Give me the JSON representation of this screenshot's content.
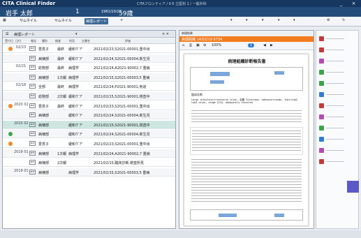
{
  "window": {
    "title": "CITA Clinical Finder",
    "subtitle": "CITAフロンティア / 9 E 立医科 1 / 一般外科",
    "min": "_",
    "close": "×"
  },
  "patient": {
    "name": "岩手 太郎",
    "id": "1",
    "dob": "1961/10/28",
    "age": "59歳"
  },
  "toolbar": {
    "items": [
      "サムネイル",
      "サムネイル",
      "病理レポート",
      "+"
    ],
    "right_items": [
      "▾",
      "▾",
      "▾",
      "▾",
      "▾",
      "⚙",
      "↻"
    ]
  },
  "left": {
    "filter": "病理レポート",
    "filter_arrow": "▾",
    "close": "× ✕",
    "columns": [
      "受付日",
      "日付",
      "報告",
      "種別",
      "検査",
      "所見",
      "文書名",
      "評価"
    ],
    "rows": [
      {
        "date": "02/23",
        "dot": "#f08a24",
        "icon": "PDF",
        "c1": "豊見子",
        "c2": "最終",
        "c3": "緩和ケア",
        "doc": "2021/02/23,S2021-00001,重中出"
      },
      {
        "date": "",
        "dot": "",
        "icon": "PDF",
        "c1": "病棟部",
        "c2": "最終",
        "c3": "緩和ケア",
        "doc": "2021/02/24,S2021-00004,新生児"
      },
      {
        "date": "02/21",
        "dot": "",
        "icon": "PDF",
        "c1": "総務部",
        "c2": "最終",
        "c3": "病理学",
        "doc": "2021/02/24,A2021-90002,7 重病"
      },
      {
        "date": "",
        "dot": "",
        "icon": "PDF",
        "c1": "病棟部",
        "c2": "1次報",
        "c3": "病理学",
        "doc": "2021/02/15,S2021-00003,5 重病"
      },
      {
        "date": "02/18",
        "dot": "",
        "icon": "PDF",
        "c1": "全部",
        "c2": "最終",
        "c3": "病理学",
        "doc": "2021/02/24,P2021-90001,気道"
      },
      {
        "date": "",
        "dot": "",
        "icon": "PDF",
        "c1": "総務部",
        "c2": "2次報",
        "c3": "緩和ケア",
        "doc": "2021/02/15,S2021-90001,検査中"
      },
      {
        "date": "2020 02/22",
        "dot": "#f08a24",
        "icon": "PDF",
        "c1": "豊見子",
        "c2": "最終",
        "c3": "緩和ケア",
        "doc": "2021/02/23,S2021-00001,重中出"
      },
      {
        "date": "",
        "dot": "",
        "icon": "PDF",
        "c1": "病棟部",
        "c2": "",
        "c3": "緩和ケア",
        "doc": "2021/02/24,S2021-00004,新生児"
      },
      {
        "date": "2020 02/20",
        "dot": "",
        "icon": "PDF",
        "c1": "病棟部",
        "c2": "",
        "c3": "緩和ケア",
        "doc": "2021/02/15,S2021-90001,検査中",
        "selected": true
      },
      {
        "date": "",
        "dot": "#3aa64c",
        "icon": "PDF",
        "c1": "病棟部",
        "c2": "",
        "c3": "緩和ケア",
        "doc": "2021/02/24,S2021-00004,新生児"
      },
      {
        "date": "",
        "dot": "#f08a24",
        "icon": "PDF",
        "c1": "豊見子",
        "c2": "",
        "c3": "緩和ケア",
        "doc": "2021/02/23,S2021-00001,重中出"
      },
      {
        "date": "2019 01/25",
        "dot": "",
        "icon": "PDF",
        "c1": "病棟部",
        "c2": "1次報",
        "c3": "病理学",
        "doc": "2021/02/24,A2021-90002,7 重病"
      },
      {
        "date": "",
        "dot": "",
        "icon": "PDF",
        "c1": "病棟部",
        "c2": "2次報",
        "c3": "",
        "doc": "2021/02/15,臨床診断,検査所見"
      },
      {
        "date": "2019 01/23",
        "dot": "",
        "icon": "PDF",
        "c1": "病棟部",
        "c2": "",
        "c3": "病理学",
        "doc": "2021/02/15,S2021-00003,5 重病"
      }
    ]
  },
  "right": {
    "tab": "病理結果",
    "doc_header": "病理組織 14/02/19 6734",
    "zoom": "100%",
    "page": "1",
    "doc_title": "病理組織診断報告書",
    "sec_label": "臨床診断",
    "body_en": [
      "Large intestine/transverse colon, 結腸 Colectomy: adenocarcinoma, tub1>tub2,",
      "tub3 colon, stage IIIA, adequately resected"
    ]
  },
  "sidebar": {
    "icon_colors": [
      "#c43a3a",
      "#c43a3a",
      "#b24bb5",
      "#3aa64c",
      "#3aa64c",
      "#2f7bd5",
      "#c43a3a",
      "#b24bb5",
      "#3aa64c",
      "#2f7bd5",
      "#b24bb5",
      "#c43a3a"
    ]
  }
}
